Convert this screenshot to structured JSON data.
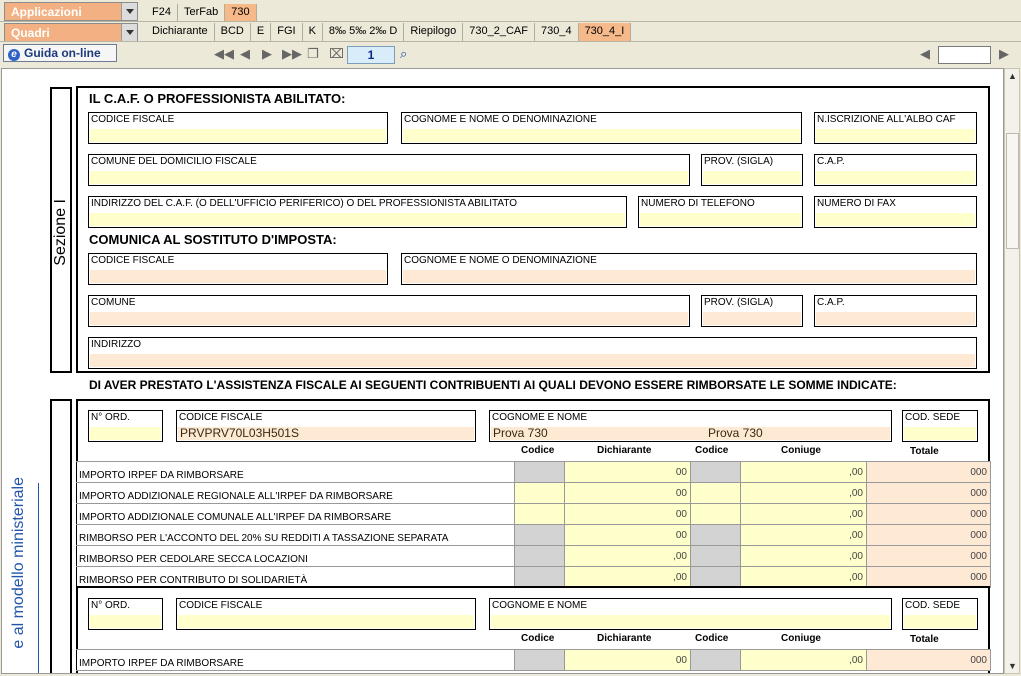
{
  "topbar": {
    "applicazioni": "Applicazioni",
    "quadri": "Quadri",
    "app_tabs": [
      "F24",
      "TerFab",
      "730"
    ],
    "quadri_tabs": [
      "Dichiarante",
      "BCD",
      "E",
      "FGI",
      "K",
      "8‰ 5‰ 2‰ D",
      "Riepilogo",
      "730_2_CAF",
      "730_4",
      "730_4_I"
    ]
  },
  "toolbar": {
    "guida": "Guida on-line",
    "page": "1"
  },
  "section1": {
    "side_label": "Sezione I",
    "caf_title": "IL C.A.F. O PROFESSIONISTA ABILITATO:",
    "caf_fields": {
      "codice_fiscale": "CODICE FISCALE",
      "cognome": "COGNOME E NOME O DENOMINAZIONE",
      "iscrizione": "N.ISCRIZIONE ALL'ALBO CAF",
      "comune_domicilio": "COMUNE DEL DOMICILIO FISCALE",
      "prov": "PROV. (SIGLA)",
      "cap": "C.A.P.",
      "indirizzo_caf": "INDIRIZZO DEL C.A.F. (O DELL'UFFICIO PERIFERICO) O DEL PROFESSIONISTA ABILITATO",
      "telefono": "NUMERO DI TELEFONO",
      "fax": "NUMERO DI FAX"
    },
    "sost_title": "COMUNICA AL SOSTITUTO D'IMPOSTA:",
    "sost_fields": {
      "codice_fiscale": "CODICE FISCALE",
      "cognome": "COGNOME E NOME O DENOMINAZIONE",
      "comune": "COMUNE",
      "prov": "PROV. (SIGLA)",
      "cap": "C.A.P.",
      "indirizzo": "INDIRIZZO"
    }
  },
  "section2": {
    "title": "DI AVER PRESTATO L'ASSISTENZA FISCALE AI SEGUENTI CONTRIBUENTI AI QUALI DEVONO ESSERE RIMBORSATE LE SOMME INDICATE:",
    "side_label": "e al modello ministeriale",
    "labels": {
      "n_ord": "N° ORD.",
      "codice_fiscale": "CODICE FISCALE",
      "cognome_nome": "COGNOME E NOME",
      "cod_sede": "COD. SEDE",
      "codice": "Codice",
      "dichiarante": "Dichiarante",
      "coniuge": "Coniuge",
      "totale": "Totale"
    },
    "contribuente1": {
      "codice_fiscale": "PRVPRV70L03H501S",
      "cognome": "Prova 730",
      "nome": "Prova 730"
    },
    "rows": [
      {
        "label": "IMPORTO IRPEF DA RIMBORSARE",
        "dich": "00",
        "con": ",00",
        "tot": "000"
      },
      {
        "label": "IMPORTO ADDIZIONALE REGIONALE ALL'IRPEF DA RIMBORSARE",
        "dich": "00",
        "con": ",00",
        "tot": "000"
      },
      {
        "label": "IMPORTO ADDIZIONALE COMUNALE ALL'IRPEF DA RIMBORSARE",
        "dich": "00",
        "con": ",00",
        "tot": "000"
      },
      {
        "label": "RIMBORSO PER L'ACCONTO DEL 20% SU REDDITI A TASSAZIONE SEPARATA",
        "dich": "00",
        "con": ",00",
        "tot": "000"
      },
      {
        "label": "RIMBORSO PER CEDOLARE SECCA LOCAZIONI",
        "dich": ",00",
        "con": ",00",
        "tot": "000"
      },
      {
        "label": "RIMBORSO PER CONTRIBUTO DI SOLIDARIETÀ",
        "dich": ",00",
        "con": ",00",
        "tot": "000"
      }
    ],
    "rows2": [
      {
        "label": "IMPORTO IRPEF DA RIMBORSARE",
        "dich": "00",
        "con": ",00",
        "tot": "000"
      }
    ]
  }
}
